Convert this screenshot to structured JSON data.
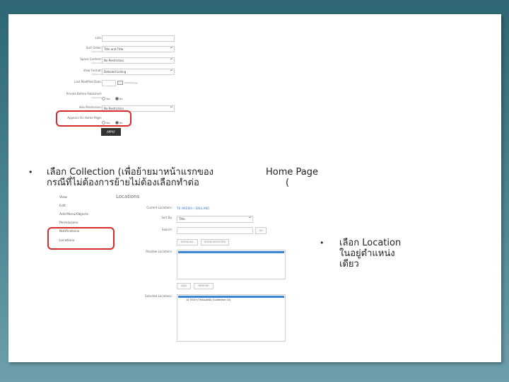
{
  "form1": {
    "fields": [
      {
        "label": "Link:",
        "sub": "",
        "type": "text",
        "value": ""
      },
      {
        "label": "Sort Order:",
        "sub": "(required)",
        "type": "select",
        "value": "Title and Title"
      },
      {
        "label": "Space Content:",
        "sub": "(required)",
        "type": "select",
        "value": "No Restriction"
      },
      {
        "label": "View Format:",
        "sub": "(optional)",
        "type": "select",
        "value": "Detailed Listing"
      },
      {
        "label": "Last Modified Date:",
        "sub": "",
        "type": "date",
        "value": "",
        "hint": "dd/mm/yyyy"
      },
      {
        "label": "Private Before Published:",
        "sub": "(required)",
        "type": "radio",
        "options": [
          "Yes",
          "No"
        ],
        "selected": 1
      },
      {
        "label": "Has Permission:",
        "sub": "(required)",
        "type": "select",
        "value": "No Restriction"
      },
      {
        "label": "Appears On Home Page:",
        "sub": "",
        "type": "radio",
        "options": [
          "Yes",
          "No"
        ],
        "selected": 1
      }
    ],
    "apply_label": "APPLY"
  },
  "bullets": [
    {
      "line1": "เลือก   Collection (เพื่อย้ายมาหน้าแรกของ",
      "line2": "กรณีที่ไม่ต้องการย้ายไม่ต้องเลือกทำต่อ"
    },
    {
      "line1": "Home Page",
      "line2": "("
    },
    {
      "line1": "เลือก   Location",
      "line2": "ในอยู่ตำแหน่ง",
      "line3": "เดียว"
    }
  ],
  "bullet_char": "•",
  "side_nav": [
    "View",
    "Edit",
    "Add Menu/Objects",
    "Permissions",
    "Notifications",
    "Locations"
  ],
  "locations": {
    "title": "Locations",
    "current_label": "Current Locations:",
    "current_value": "TK (MIDSH) / ENGLAND",
    "sort_label": "Sort By:",
    "sort_value": "Title",
    "search_label": "Search:",
    "search_btn": "Go",
    "btn_show_all": "SHOW ALL",
    "btn_show_selected": "SHOW SELECTED",
    "possible_label": "Possible Locations:",
    "btn_add": "ADD",
    "btn_remove": "REMOVE",
    "selected_label": "Selected Locations:",
    "selected_item": "10 TECH (THAILAND) (Collection 10)"
  }
}
